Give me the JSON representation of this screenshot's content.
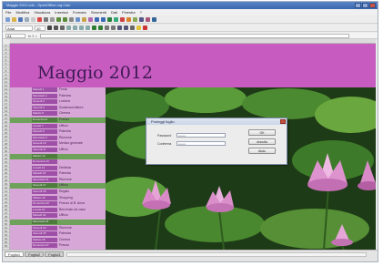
{
  "window": {
    "title": "Maggio 2012.ods - OpenOffice.org Calc"
  },
  "menu": [
    "File",
    "Modifica",
    "Visualizza",
    "Inserisci",
    "Formato",
    "Strumenti",
    "Dati",
    "Finestra",
    "?"
  ],
  "toolbar": {
    "font_name": "Arial",
    "font_size": "10"
  },
  "formula_bar": {
    "cell_ref": "A1",
    "fx_label": "fx  Σ  ="
  },
  "sheet": {
    "banner_title": "Maggio 2012",
    "rows": [
      "1",
      "2",
      "3",
      "4",
      "5",
      "6",
      "7",
      "8",
      "9",
      "10",
      "11",
      "12",
      "13",
      "14",
      "15",
      "16",
      "17",
      "18",
      "19",
      "20",
      "21",
      "22",
      "23",
      "24",
      "25",
      "26",
      "27",
      "28",
      "29",
      "30",
      "31",
      "32",
      "33",
      "34",
      "35",
      "36",
      "37",
      "38",
      "39",
      "40",
      "41",
      "42",
      "43",
      "44",
      "45",
      "46",
      "47",
      "48",
      "49",
      "50",
      "51",
      "52",
      "53",
      "54",
      "55",
      "56"
    ],
    "days": [
      {
        "day": "Martedì 1",
        "event": "Festa",
        "band": false
      },
      {
        "day": "Mercoledì 2",
        "event": "Palestra",
        "band": false
      },
      {
        "day": "Giovedì 3",
        "event": "Lezione",
        "band": false
      },
      {
        "day": "Venerdì 4",
        "event": "Scadenza fattura",
        "band": false
      },
      {
        "day": "Sabato 5",
        "event": "Cinema",
        "band": false
      },
      {
        "day": "Domenica 6",
        "event": "Pranzo",
        "band": true
      },
      {
        "day": "Lunedì 7",
        "event": "Ufficio",
        "band": false
      },
      {
        "day": "Martedì 8",
        "event": "Palestra",
        "band": false
      },
      {
        "day": "Mercoledì 9",
        "event": "Riunione",
        "band": false
      },
      {
        "day": "Giovedì 10",
        "event": "Medico generale",
        "band": false
      },
      {
        "day": "Venerdì 11",
        "event": "Ufficio",
        "band": false
      },
      {
        "day": "Sabato 12",
        "event": "",
        "band": true
      },
      {
        "day": "Domenica 13",
        "event": "",
        "band": false
      },
      {
        "day": "Lunedì 14",
        "event": "Dentista",
        "band": false
      },
      {
        "day": "Martedì 15",
        "event": "Palestra",
        "band": false
      },
      {
        "day": "Mercoledì 16",
        "event": "Riunione",
        "band": false
      },
      {
        "day": "Giovedì 17",
        "event": "Ufficio",
        "band": true
      },
      {
        "day": "Venerdì 18",
        "event": "Regalo",
        "band": false
      },
      {
        "day": "Sabato 19",
        "event": "Shopping",
        "band": false
      },
      {
        "day": "Domenica 20",
        "event": "Pranzo di B. Anna",
        "band": false
      },
      {
        "day": "Lunedì 21",
        "event": "Benzinaio da casa",
        "band": false
      },
      {
        "day": "Martedì 22",
        "event": "Ufficio",
        "band": false
      },
      {
        "day": "Mercoledì 23",
        "event": "",
        "band": true
      },
      {
        "day": "Giovedì 24",
        "event": "Riunione",
        "band": false
      },
      {
        "day": "Venerdì 25",
        "event": "Palestra",
        "band": false
      },
      {
        "day": "Sabato 26",
        "event": "Cinema",
        "band": false
      },
      {
        "day": "Domenica 27",
        "event": "Pranzo",
        "band": false
      }
    ]
  },
  "dialog": {
    "title": "Proteggi foglio",
    "password_label": "Password",
    "password_value": "••••••••",
    "confirm_label": "Conferma",
    "confirm_value": "••••••••",
    "ok_label": "OK",
    "cancel_label": "Annulla",
    "help_label": "Aiuto"
  },
  "status": {
    "tabs": [
      "Foglio1",
      "Foglio2",
      "Foglio3"
    ],
    "active_tab": "Foglio1"
  },
  "colors": {
    "banner": "#c75bbf",
    "list_bg": "#d7a7d7",
    "day_cell": "#9e4fa6",
    "week_band": "#6ea25a"
  }
}
